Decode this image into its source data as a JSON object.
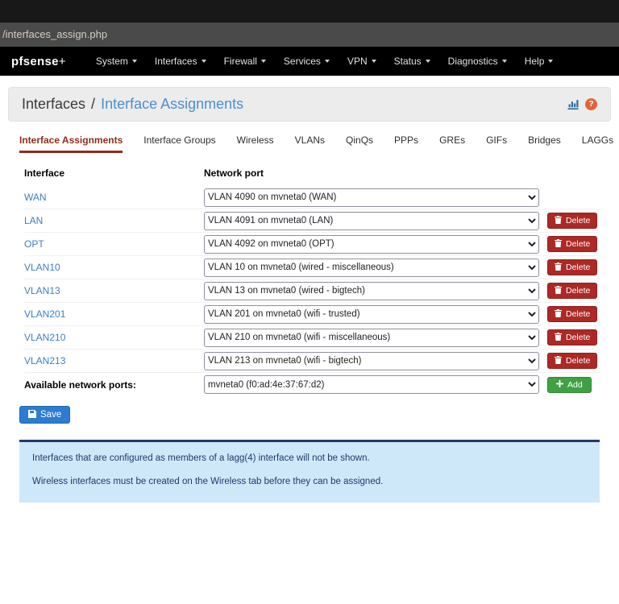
{
  "chrome": {
    "url": "/interfaces_assign.php"
  },
  "navbar": {
    "brand": "pfsense",
    "brand_plus": "+",
    "items": [
      {
        "label": "System"
      },
      {
        "label": "Interfaces"
      },
      {
        "label": "Firewall"
      },
      {
        "label": "Services"
      },
      {
        "label": "VPN"
      },
      {
        "label": "Status"
      },
      {
        "label": "Diagnostics"
      },
      {
        "label": "Help"
      }
    ]
  },
  "header": {
    "section": "Interfaces",
    "separator": "/",
    "title": "Interface Assignments",
    "help_glyph": "?"
  },
  "tabs": [
    {
      "label": "Interface Assignments",
      "active": true
    },
    {
      "label": "Interface Groups",
      "active": false
    },
    {
      "label": "Wireless",
      "active": false
    },
    {
      "label": "VLANs",
      "active": false
    },
    {
      "label": "QinQs",
      "active": false
    },
    {
      "label": "PPPs",
      "active": false
    },
    {
      "label": "GREs",
      "active": false
    },
    {
      "label": "GIFs",
      "active": false
    },
    {
      "label": "Bridges",
      "active": false
    },
    {
      "label": "LAGGs",
      "active": false
    }
  ],
  "assignments": {
    "col_interface": "Interface",
    "col_port": "Network port",
    "rows": [
      {
        "name": "WAN",
        "port": "VLAN 4090 on mvneta0 (WAN)",
        "deletable": false
      },
      {
        "name": "LAN",
        "port": "VLAN 4091 on mvneta0 (LAN)",
        "deletable": true
      },
      {
        "name": "OPT",
        "port": "VLAN 4092 on mvneta0 (OPT)",
        "deletable": true
      },
      {
        "name": "VLAN10",
        "port": "VLAN 10 on mvneta0 (wired - miscellaneous)",
        "deletable": true
      },
      {
        "name": "VLAN13",
        "port": "VLAN 13 on mvneta0 (wired - bigtech)",
        "deletable": true
      },
      {
        "name": "VLAN201",
        "port": "VLAN 201 on mvneta0 (wifi - trusted)",
        "deletable": true
      },
      {
        "name": "VLAN210",
        "port": "VLAN 210 on mvneta0 (wifi - miscellaneous)",
        "deletable": true
      },
      {
        "name": "VLAN213",
        "port": "VLAN 213 on mvneta0 (wifi - bigtech)",
        "deletable": true
      }
    ],
    "available_label": "Available network ports:",
    "available_port": "mvneta0 (f0:ad:4e:37:67:d2)",
    "delete_label": "Delete",
    "add_label": "Add",
    "save_label": "Save"
  },
  "notes": {
    "line1": "Interfaces that are configured as members of a lagg(4) interface will not be shown.",
    "line2": "Wireless interfaces must be created on the Wireless tab before they can be assigned."
  },
  "colors": {
    "navbar_bg": "#000000",
    "accent_blue": "#4d8fcc",
    "link_blue": "#3b7fc4",
    "tab_active": "#8f2c1c",
    "danger_red": "#ac2925",
    "success_green": "#3fa142",
    "primary_blue": "#2c7cd1",
    "info_bg": "#cfe8f9",
    "info_border": "#1e3a68"
  }
}
